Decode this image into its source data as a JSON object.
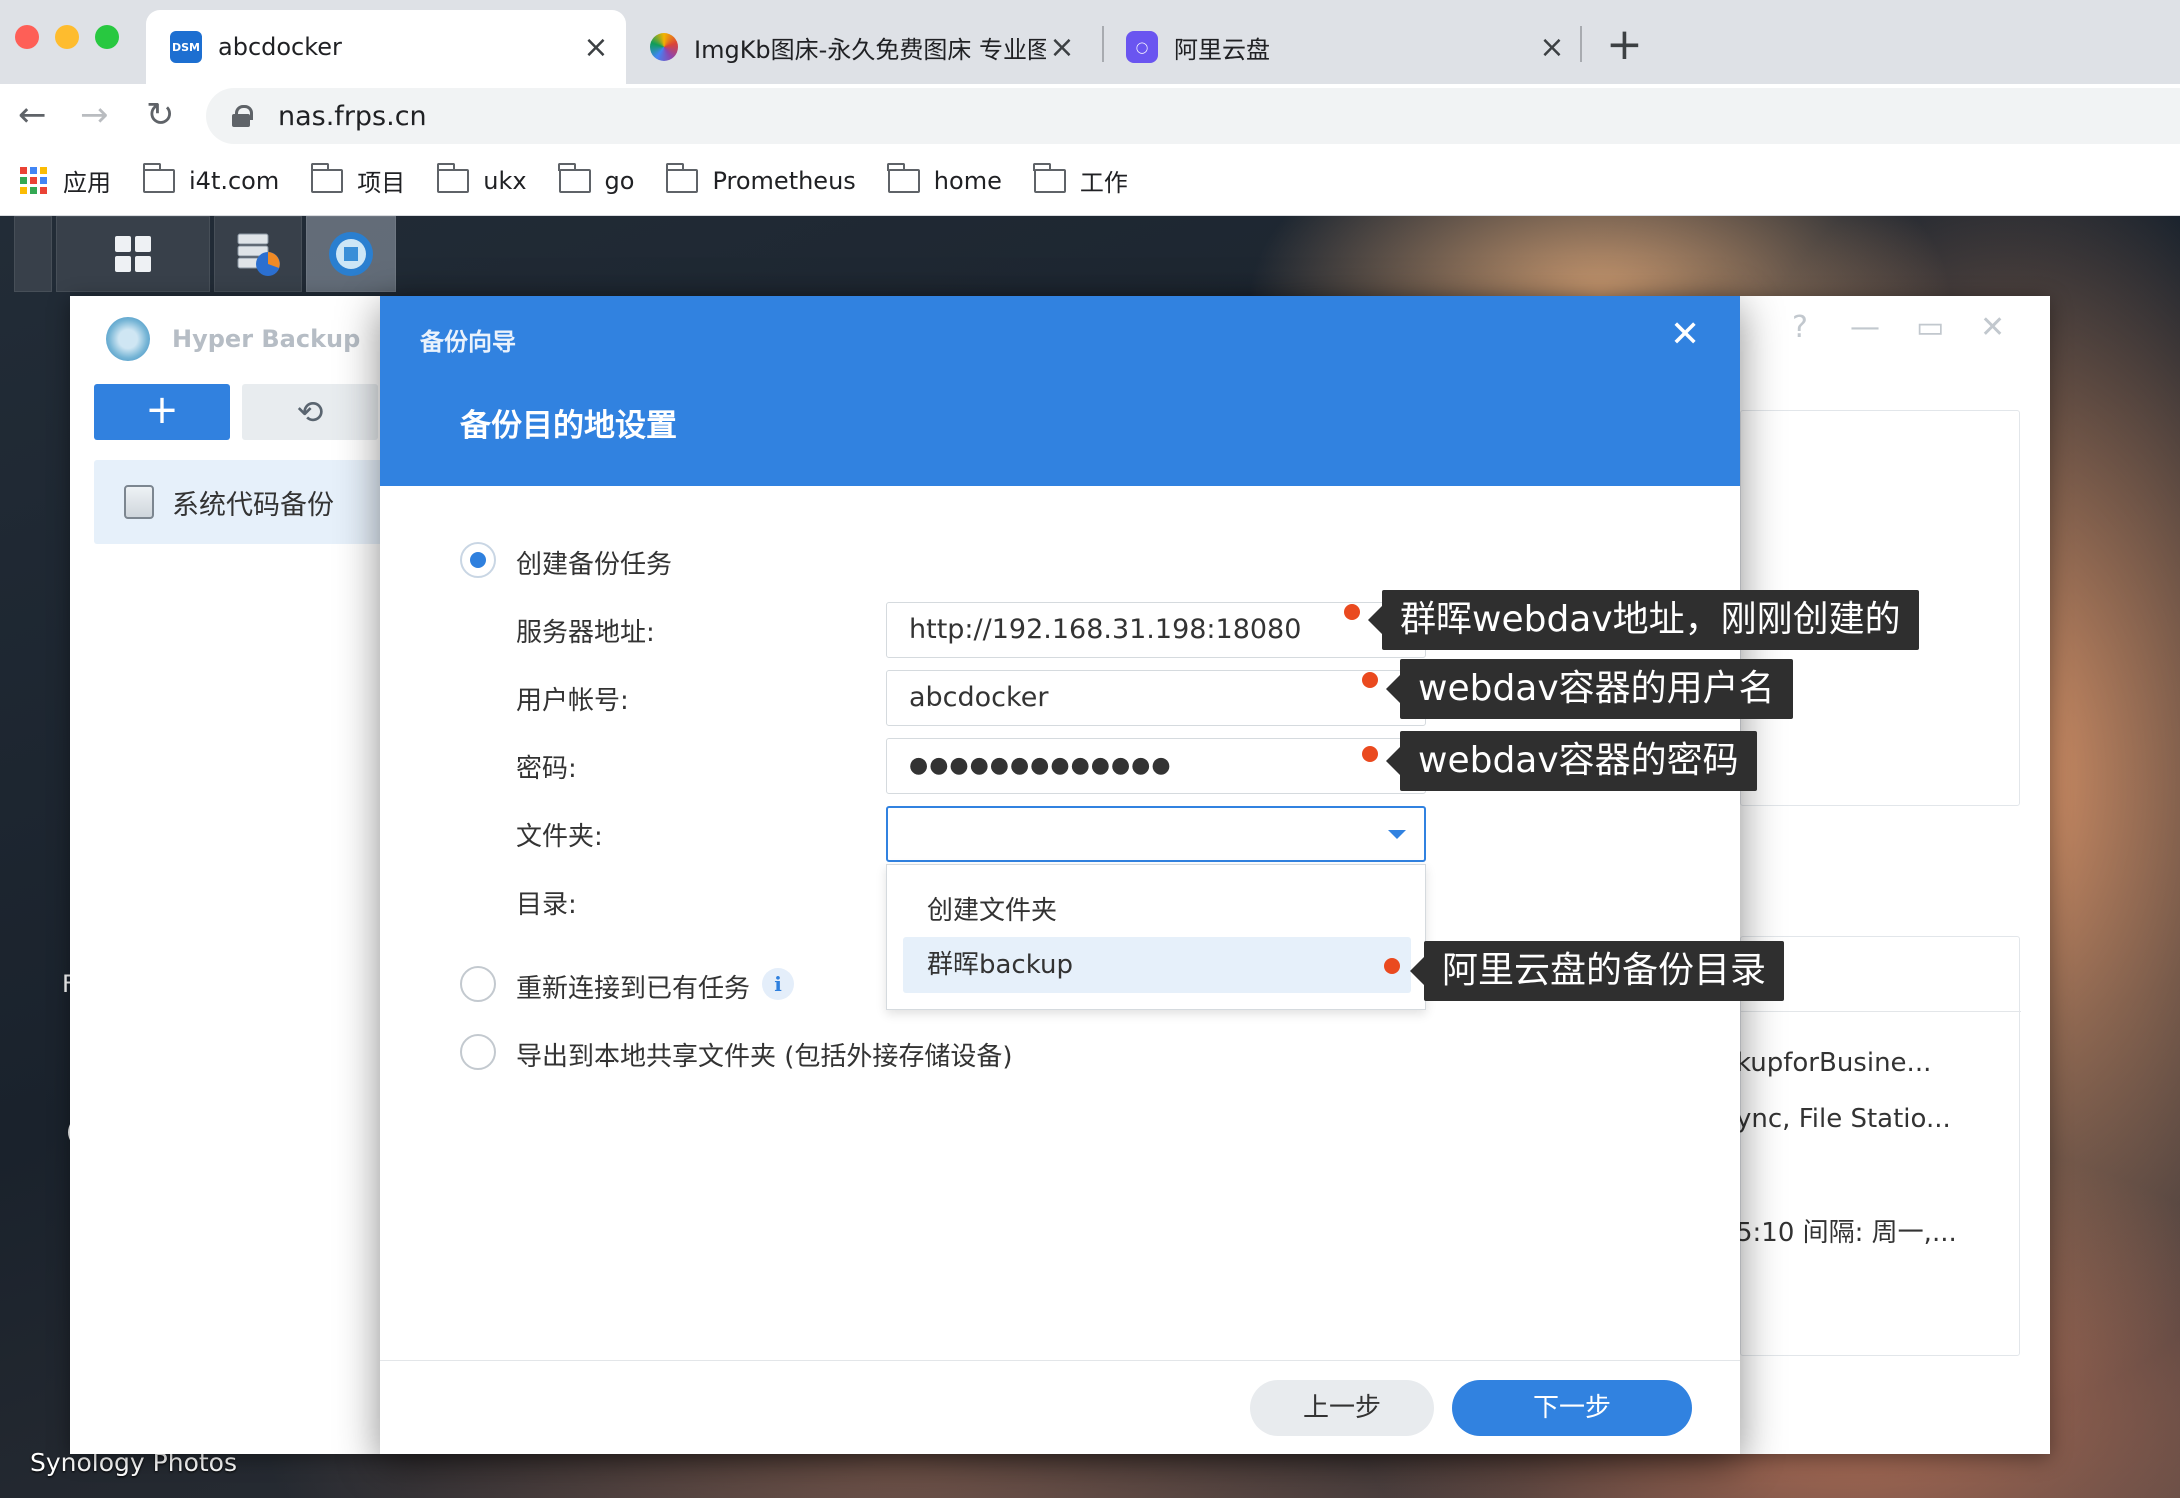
{
  "browser": {
    "tabs": [
      {
        "title": "abcdocker",
        "favicon_text": "DSM",
        "active": true
      },
      {
        "title": "ImgKb图床-永久免费图床 专业图",
        "active": false
      },
      {
        "title": "阿里云盘",
        "active": false
      }
    ],
    "new_tab": "+",
    "url": "nas.frps.cn",
    "bookmarks": [
      "应用",
      "i4t.com",
      "项目",
      "ukx",
      "go",
      "Prometheus",
      "home",
      "工作"
    ]
  },
  "desktop": {
    "label": "Synology Photos",
    "frag1": "F",
    "frag2": "("
  },
  "hyper_backup": {
    "title": "Hyper Backup",
    "add_label": "+",
    "restore_icon": "⟲",
    "task_name": "系统代码备份",
    "details": [
      "kupforBusine...",
      "ync, File Statio...",
      "5:10 间隔: 周一,..."
    ],
    "controls": [
      "?",
      "—",
      "▭",
      "✕"
    ]
  },
  "wizard": {
    "window_title": "备份向导",
    "close": "✕",
    "step_title": "备份目的地设置",
    "options": {
      "create": "创建备份任务",
      "reconnect": "重新连接到已有任务",
      "export": "导出到本地共享文件夹 (包括外接存储设备)"
    },
    "info_icon": "i",
    "fields": {
      "server_label": "服务器地址:",
      "server_value": "http://192.168.31.198:18080",
      "user_label": "用户帐号:",
      "user_value": "abcdocker",
      "password_label": "密码:",
      "password_value": "●●●●●●●●●●●●●",
      "folder_label": "文件夹:",
      "folder_value": "",
      "dir_label": "目录:"
    },
    "dropdown_options": [
      "创建文件夹",
      "群晖backup"
    ],
    "buttons": {
      "prev": "上一步",
      "next": "下一步"
    }
  },
  "annotations": [
    "群晖webdav地址，刚刚创建的",
    "webdav容器的用户名",
    "webdav容器的密码",
    "阿里云盘的备份目录"
  ],
  "colors": {
    "accent": "#3182e0",
    "annotation_dot": "#ea4a1f",
    "callout_bg": "#2f2f2f"
  }
}
